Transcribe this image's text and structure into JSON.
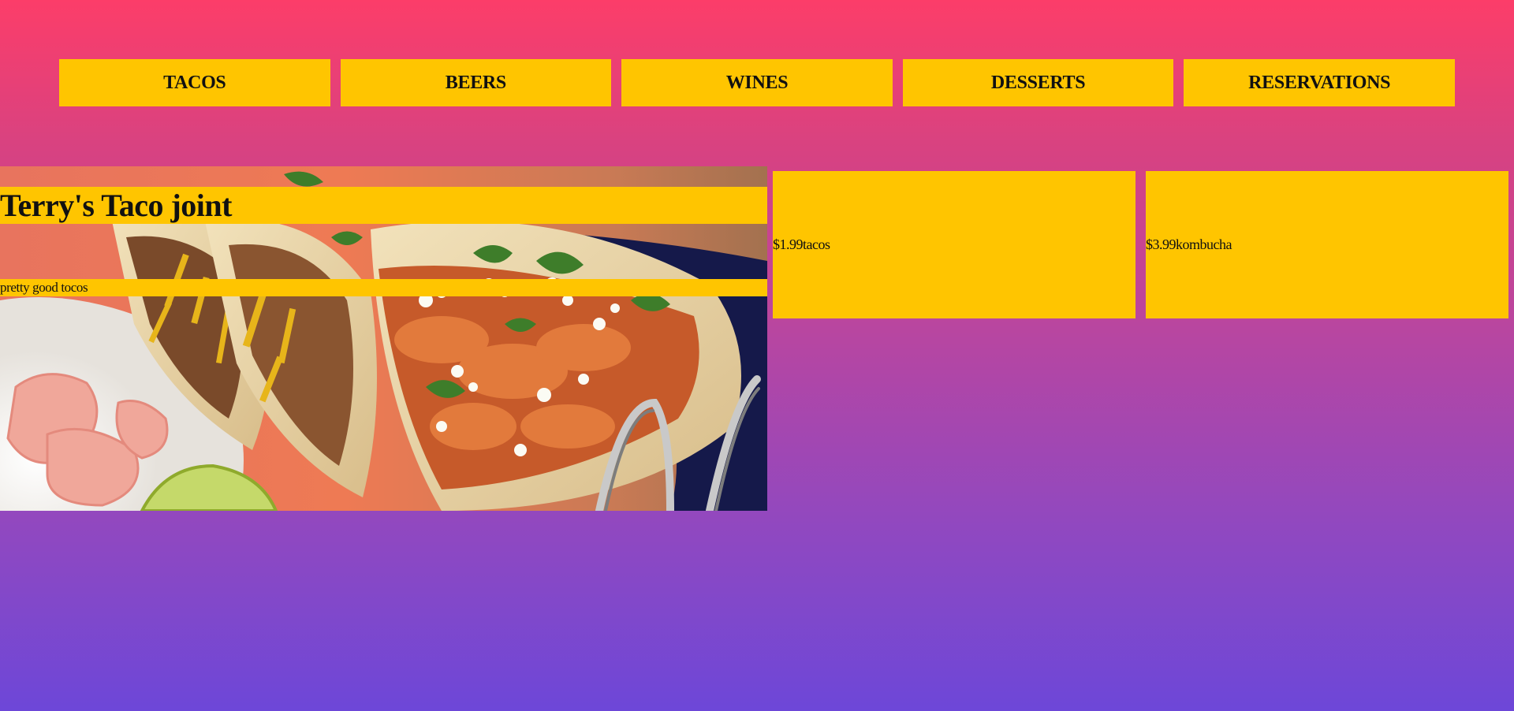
{
  "colors": {
    "accent": "#ffc500",
    "gradient_top": "#fc3d69",
    "gradient_bottom": "#6d47d8",
    "text": "#111111"
  },
  "nav": {
    "items": [
      {
        "label": "TACOS"
      },
      {
        "label": "BEERS"
      },
      {
        "label": "WINES"
      },
      {
        "label": "DESSERTS"
      },
      {
        "label": "RESERVATIONS"
      }
    ]
  },
  "hero": {
    "title": "Terry's Taco joint",
    "tagline": "pretty good tocos",
    "image_icon": "tacos-photo"
  },
  "menu_items": [
    {
      "price": "$1.99",
      "name": "tacos"
    },
    {
      "price": "$3.99",
      "name": "kombucha"
    }
  ]
}
